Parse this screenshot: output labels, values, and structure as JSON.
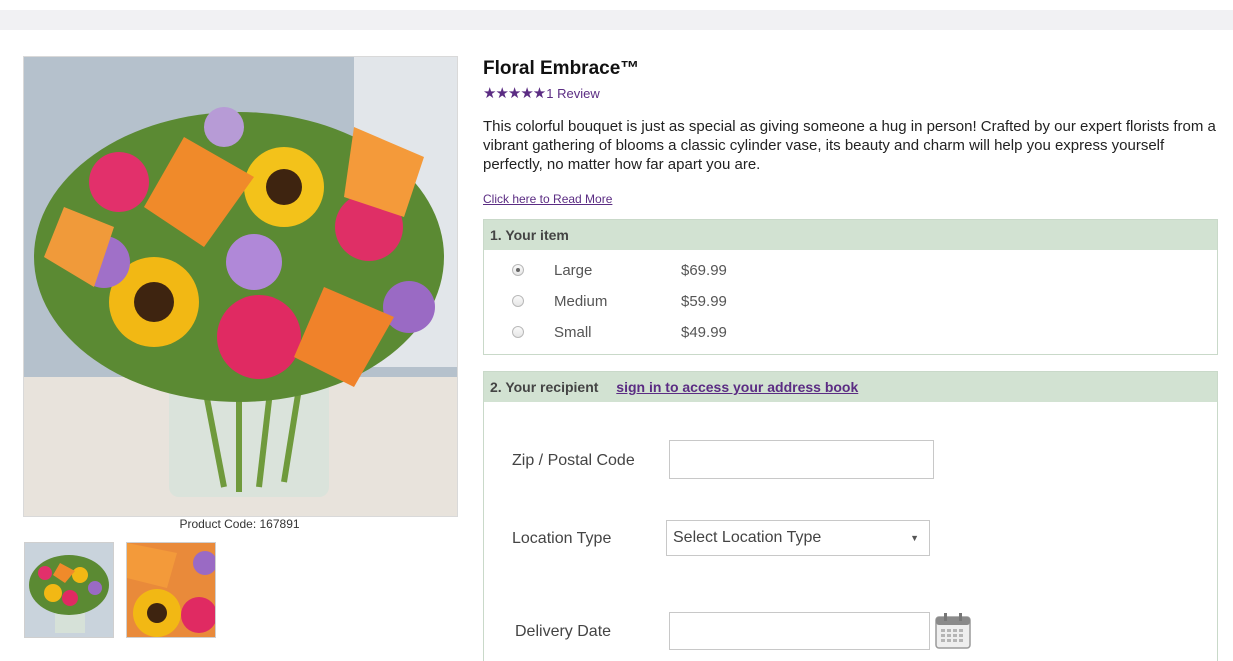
{
  "product": {
    "title": "Floral Embrace™",
    "stars": "★★★★★",
    "review_text": "1 Review",
    "description": "This colorful bouquet is just as special as giving someone a hug in person! Crafted by our expert florists from a vibrant gathering of blooms a classic cylinder vase, its beauty and charm will help you express yourself perfectly, no matter how far apart you are.",
    "read_more": "Click here to Read More",
    "product_code": "Product Code: 167891"
  },
  "item_panel": {
    "header": "1. Your item",
    "options": [
      {
        "label": "Large",
        "price": "$69.99",
        "selected": true
      },
      {
        "label": "Medium",
        "price": "$59.99",
        "selected": false
      },
      {
        "label": "Small",
        "price": "$49.99",
        "selected": false
      }
    ]
  },
  "recipient_panel": {
    "header": "2. Your recipient",
    "signin_link": "sign in to access your address book",
    "zip_label": "Zip / Postal Code",
    "zip_value": "",
    "location_label": "Location Type",
    "location_selected": "Select Location Type",
    "delivery_label": "Delivery Date",
    "delivery_value": ""
  },
  "icons": {
    "calendar": "calendar-icon",
    "select_arrow": "chevron-down-icon"
  },
  "colors": {
    "accent_purple": "#5b2c83",
    "panel_header_green": "#d2e2d2"
  }
}
